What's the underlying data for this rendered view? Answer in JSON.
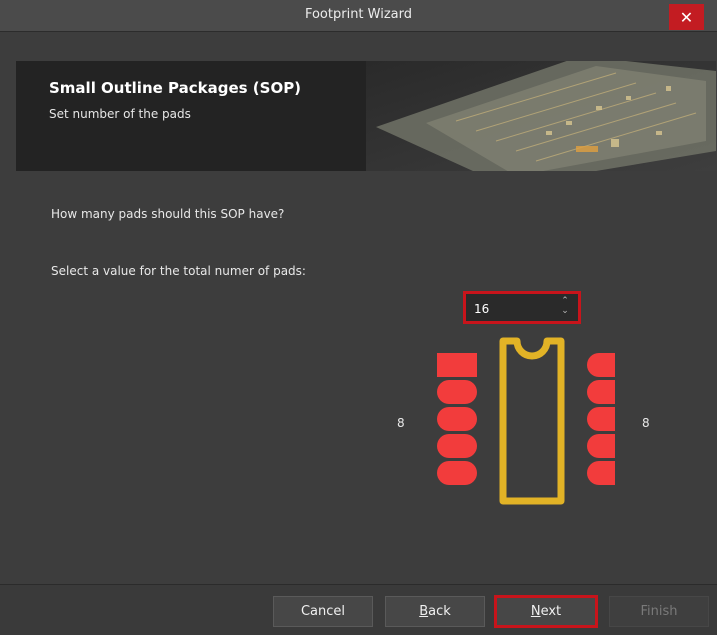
{
  "window": {
    "title": "Footprint Wizard",
    "close_symbol": "✕"
  },
  "banner": {
    "title": "Small Outline Packages (SOP)",
    "subtitle": "Set number of the pads"
  },
  "content": {
    "question": "How many pads should this SOP have?",
    "instruction": "Select a value for the total numer of pads:",
    "pad_count_value": "16",
    "left_pad_count": "8",
    "right_pad_count": "8"
  },
  "footer": {
    "cancel_label": "Cancel",
    "back_accel": "B",
    "back_rest": "ack",
    "next_accel": "N",
    "next_rest": "ext",
    "finish_label": "Finish"
  },
  "colors": {
    "pad": "#f23c3c",
    "body_outline": "#e2b326",
    "highlight": "#c8141b"
  }
}
